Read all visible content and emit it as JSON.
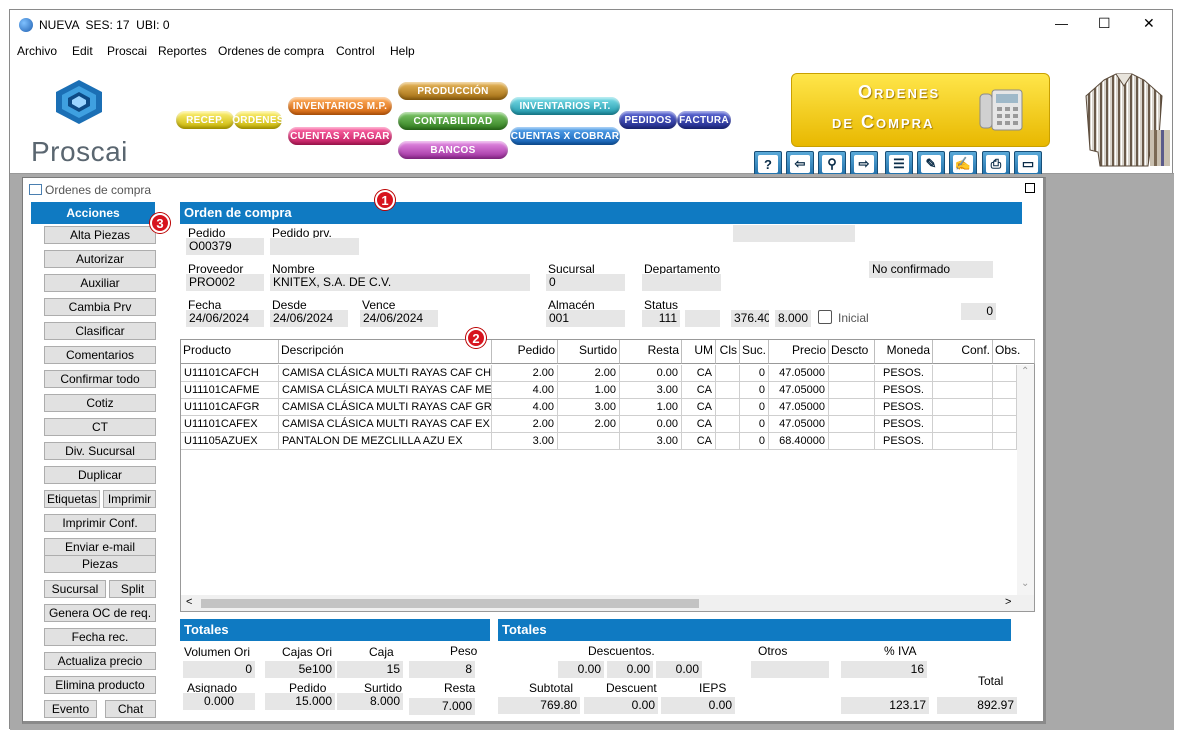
{
  "window": {
    "title": "NUEVA  SES: 17  UBI: 0",
    "controls": {
      "minimize": "—",
      "maximize": "☐",
      "close": "✕"
    }
  },
  "menu": [
    "Archivo",
    "Edit",
    "Proscai",
    "Reportes",
    "Ordenes de compra",
    "Control",
    "Help"
  ],
  "brand": {
    "name": "Proscai",
    "banner_line1": "Ordenes",
    "banner_line2": "de Compra"
  },
  "modules": {
    "recep": "RECEP.",
    "ordenes": "ORDENES",
    "inventarios_mp": "INVENTARIOS M.P.",
    "cuentas_pagar": "CUENTAS X PAGAR",
    "produccion": "PRODUCCIÓN",
    "contabilidad": "CONTABILIDAD",
    "bancos": "BANCOS",
    "inventarios_pt": "INVENTARIOS P.T.",
    "cuentas_cobrar": "CUENTAS X COBRAR",
    "pedidos": "PEDIDOS",
    "factura": "FACTURA"
  },
  "toolbar_icons": [
    "?",
    "⇦",
    "⚲",
    "⇨",
    "☰",
    "✎",
    "✍",
    "⎙",
    "▭"
  ],
  "subwindow": {
    "title": "Ordenes de compra"
  },
  "actions": {
    "header": "Acciones",
    "items": [
      "Alta Piezas",
      "Autorizar",
      "Auxiliar",
      "Cambia Prv",
      "Clasificar",
      "Comentarios",
      "Confirmar todo",
      "Cotiz",
      "CT",
      "Div. Sucursal",
      "Duplicar"
    ],
    "etiquetas": "Etiquetas",
    "imprimir": "Imprimir",
    "items2": [
      "Imprimir Conf.",
      "Enviar e-mail"
    ],
    "piezas": "Piezas",
    "sucursal": "Sucursal",
    "split": "Split",
    "items3": [
      "Genera OC de req.",
      "Fecha rec.",
      "Actualiza precio",
      "Elimina producto"
    ],
    "evento": "Evento",
    "chat": "Chat"
  },
  "order": {
    "section_title": "Orden de compra",
    "pedido_label": "Pedido",
    "pedido": "O00379",
    "pedido_prv_label": "Pedido prv.",
    "pedido_prv": "",
    "proveedor_label": "Proveedor",
    "proveedor": "PRO002",
    "nombre_label": "Nombre",
    "nombre": "KNITEX, S.A. DE C.V.",
    "sucursal_label": "Sucursal",
    "sucursal": "0",
    "departamento_label": "Departamento",
    "departamento": "",
    "estado": "No confirmado",
    "fecha_label": "Fecha",
    "fecha": "24/06/2024",
    "desde_label": "Desde",
    "desde": "24/06/2024",
    "vence_label": "Vence",
    "vence": "24/06/2024",
    "almacen_label": "Almacén",
    "almacen": "001",
    "status_label": "Status",
    "status": "111",
    "tc1": "376.40",
    "tc2": "8.000",
    "inicial_label": "Inicial",
    "counter": "0"
  },
  "grid": {
    "headers": [
      "Producto",
      "Descripción",
      "Pedido",
      "Surtido",
      "Resta",
      "UM",
      "Cls",
      "Suc.",
      "Precio",
      "Descto",
      "Moneda",
      "Conf.",
      "Obs."
    ],
    "rows": [
      [
        "U11101CAFCH",
        "CAMISA CLÁSICA MULTI RAYAS CAF CH",
        "2.00",
        "2.00",
        "0.00",
        "CA",
        "",
        "0",
        "47.05000",
        "",
        "PESOS.",
        "",
        ""
      ],
      [
        "U11101CAFME",
        "CAMISA CLÁSICA MULTI RAYAS CAF ME",
        "4.00",
        "1.00",
        "3.00",
        "CA",
        "",
        "0",
        "47.05000",
        "",
        "PESOS.",
        "",
        ""
      ],
      [
        "U11101CAFGR",
        "CAMISA CLÁSICA MULTI RAYAS CAF GR",
        "4.00",
        "3.00",
        "1.00",
        "CA",
        "",
        "0",
        "47.05000",
        "",
        "PESOS.",
        "",
        ""
      ],
      [
        "U11101CAFEX",
        "CAMISA CLÁSICA MULTI RAYAS CAF EX",
        "2.00",
        "2.00",
        "0.00",
        "CA",
        "",
        "0",
        "47.05000",
        "",
        "PESOS.",
        "",
        ""
      ],
      [
        "U11105AZUEX",
        "PANTALON DE MEZCLILLA AZU EX",
        "3.00",
        "",
        "3.00",
        "CA",
        "",
        "0",
        "68.40000",
        "",
        "PESOS.",
        "",
        ""
      ]
    ]
  },
  "totals_left": {
    "title": "Totales",
    "volumen_label": "Volumen Ori",
    "volumen": "0",
    "cajas_label": "Cajas Ori",
    "cajas": "5e100",
    "caja_label": "Caja",
    "caja": "15",
    "peso_label": "Peso",
    "peso": "8",
    "asignado_label": "Asignado",
    "asignado": "0.000",
    "pedido_label": "Pedido",
    "pedido": "15.000",
    "surtido_label": "Surtido",
    "surtido": "8.000",
    "resta_label": "Resta",
    "resta": "7.000"
  },
  "totals_right": {
    "title": "Totales",
    "descuentos_label": "Descuentos.",
    "d1": "0.00",
    "d2": "0.00",
    "d3": "0.00",
    "otros_label": "Otros",
    "otros": "",
    "iva_label": "% IVA",
    "iva": "16",
    "total_label": "Total",
    "total": "892.97",
    "subtotal_label": "Subtotal",
    "subtotal": "769.80",
    "descuent_label": "Descuent",
    "descuent": "0.00",
    "ieps_label": "IEPS",
    "ieps": "0.00",
    "iva_amount": "123.17"
  },
  "badges": [
    "1",
    "2",
    "3"
  ]
}
